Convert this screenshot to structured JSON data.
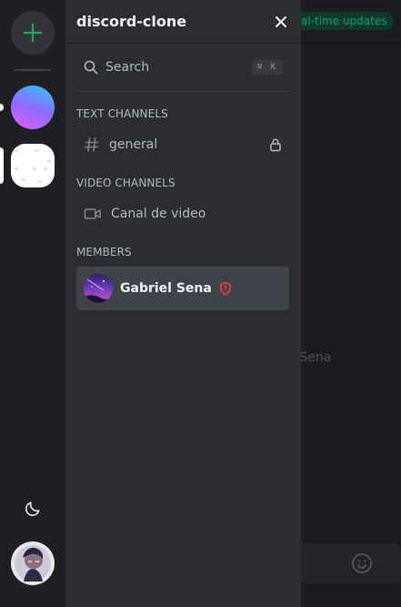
{
  "app": {
    "server_name": "discord-clone",
    "accent_color": "#23a55a",
    "admin_color": "#f23f42"
  },
  "rail": {
    "add_server_icon": "plus-icon",
    "theme_icon": "moon-icon"
  },
  "search": {
    "label": "Search",
    "shortcut": "⌘ K"
  },
  "sections": {
    "text": {
      "title": "TEXT CHANNELS",
      "channels": [
        {
          "name": "general",
          "icon": "hash-icon",
          "locked": true
        }
      ]
    },
    "video": {
      "title": "VIDEO CHANNELS",
      "channels": [
        {
          "name": "Canal de video",
          "icon": "video-icon"
        }
      ]
    },
    "members": {
      "title": "MEMBERS",
      "items": [
        {
          "name": "Gabriel Sena",
          "role_icon": "shield-alert-icon"
        }
      ]
    }
  },
  "background": {
    "badge_text": "al-time updates",
    "member_name_partial": "l Sena"
  }
}
